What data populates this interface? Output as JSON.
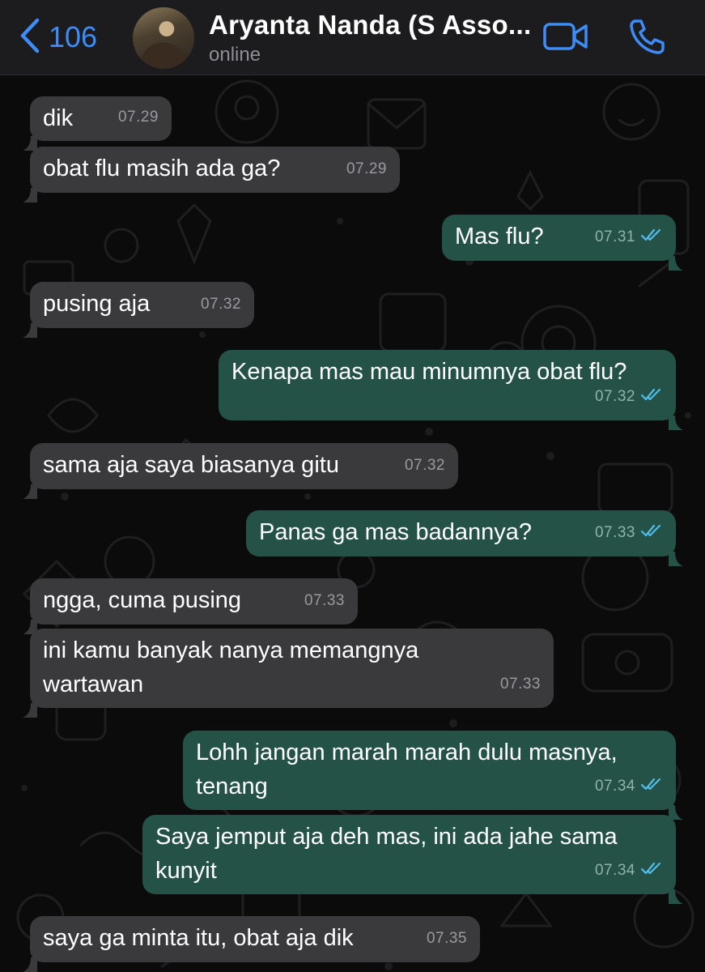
{
  "header": {
    "back_count": "106",
    "contact_name": "Aryanta Nanda (S Asso...",
    "status": "online"
  },
  "colors": {
    "accent": "#3e8cf7",
    "incoming_bubble": "#3a3a3c",
    "outgoing_bubble": "#245247",
    "read_ticks": "#53bdeb"
  },
  "icons": {
    "back": "chevron-left-icon",
    "video": "video-camera-icon",
    "call": "phone-icon",
    "read_receipt": "double-check-icon"
  },
  "messages": [
    {
      "dir": "in",
      "text": "dik",
      "time": "07.29"
    },
    {
      "dir": "in",
      "text": "obat flu masih ada ga?",
      "time": "07.29"
    },
    {
      "dir": "out",
      "text": "Mas flu?",
      "time": "07.31"
    },
    {
      "dir": "in",
      "text": "pusing aja",
      "time": "07.32"
    },
    {
      "dir": "out",
      "text": "Kenapa mas mau minumnya obat flu?",
      "time": "07.32"
    },
    {
      "dir": "in",
      "text": "sama aja saya biasanya gitu",
      "time": "07.32"
    },
    {
      "dir": "out",
      "text": "Panas ga mas badannya?",
      "time": "07.33"
    },
    {
      "dir": "in",
      "text": "ngga, cuma pusing",
      "time": "07.33"
    },
    {
      "dir": "in",
      "text": "ini kamu banyak nanya memangnya\nwartawan",
      "time": "07.33"
    },
    {
      "dir": "out",
      "text": "Lohh jangan marah marah dulu masnya,\ntenang",
      "time": "07.34"
    },
    {
      "dir": "out",
      "text": "Saya jemput aja deh mas, ini ada jahe sama\nkunyit",
      "time": "07.34"
    },
    {
      "dir": "in",
      "text": "saya ga minta itu, obat aja dik",
      "time": "07.35"
    }
  ]
}
